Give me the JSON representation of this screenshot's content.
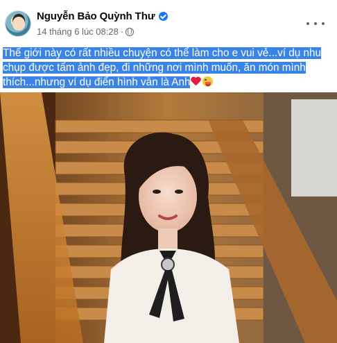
{
  "post": {
    "author_name": "Nguyễn Bảo Quỳnh Thư",
    "timestamp": "14 tháng 6 lúc 08:28",
    "separator": "·",
    "audience_icon": "globe-icon",
    "verified_icon": "verified-badge-icon",
    "more_icon": "more-options-icon",
    "message_lines": [
      "Thế giới này có rất nhiều chuyện có thể làm cho e vui vẻ...ví dụ nhu",
      "chụp được tấm ảnh đẹp, đi những nơi mình muốn, ăn món mình",
      "thích...nhưng ví dụ điển hình vẫn là Anh"
    ],
    "emojis": [
      "heart-icon",
      "wink-icon"
    ],
    "photo_alt": "photo"
  },
  "colors": {
    "selection": "#3a84e8",
    "verified": "#1877f2",
    "heart": "#e41e3f"
  }
}
